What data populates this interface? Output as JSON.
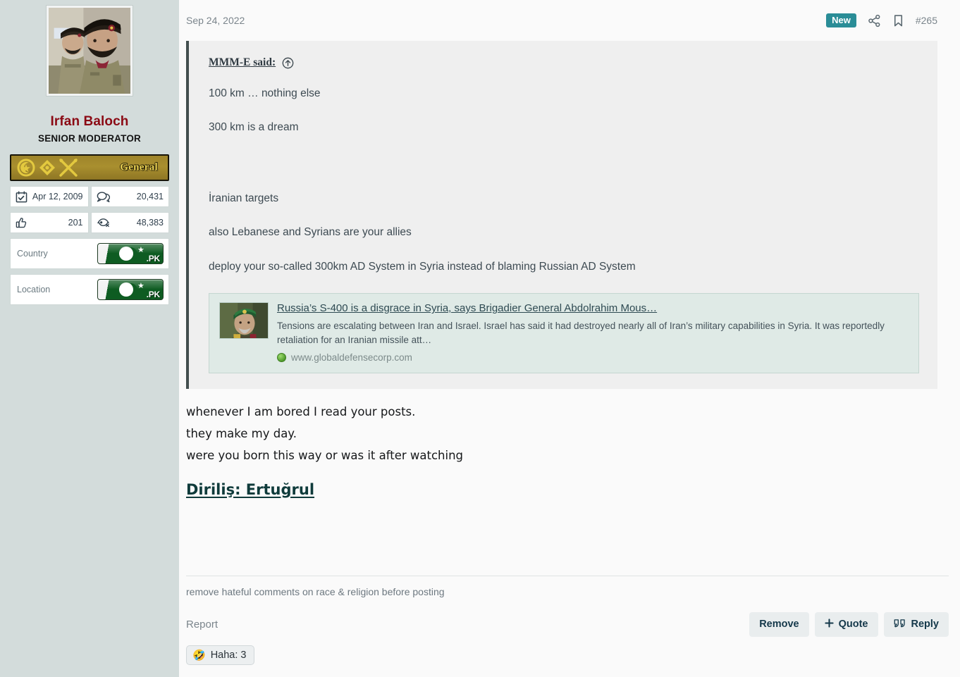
{
  "colors": {
    "sidebar_bg": "#d3dcdb",
    "main_bg": "#fafafa",
    "accent_teal": "#2a8d97",
    "username": "#8b0a14",
    "quote_bg": "#efefef",
    "quote_border": "#434f4f",
    "link_card_bg": "#dfeae6",
    "rank_badge_gold": "#a98f2f",
    "flag_green": "#0e5c22"
  },
  "sidebar": {
    "avatar_alt": "two-soldiers-avatar",
    "username": "Irfan Baloch",
    "user_title": "SENIOR MODERATOR",
    "rank": {
      "label": "General",
      "insignia": [
        "crescent-star-icon",
        "diamond-pip-icon",
        "crossed-batons-icon"
      ]
    },
    "stats": [
      {
        "icon": "calendar-icon",
        "value": "Apr 12, 2009",
        "name": "joined-date"
      },
      {
        "icon": "messages-icon",
        "value": "20,431",
        "name": "message-count"
      },
      {
        "icon": "thumbs-up-icon",
        "value": "201",
        "name": "likes-count"
      },
      {
        "icon": "reactions-icon",
        "value": "48,383",
        "name": "reaction-score"
      }
    ],
    "info": [
      {
        "label": "Country",
        "flag": "pakistan-flag",
        "tld": ".PK"
      },
      {
        "label": "Location",
        "flag": "pakistan-flag",
        "tld": ".PK"
      }
    ]
  },
  "post": {
    "date": "Sep 24, 2022",
    "new_badge": "New",
    "share_icon": "share-icon",
    "bookmark_icon": "bookmark-icon",
    "post_number": "#265",
    "quote": {
      "author": "MMM-E",
      "said_suffix": " said:",
      "jump_icon": "jump-to-post-icon",
      "lines": [
        "100 km … nothing else",
        "300 km is a dream"
      ],
      "lines2": [
        "İranian targets",
        "also Lebanese and Syrians are your allies",
        "deploy your so-called 300km AD System in Syria instead of blaming Russian AD System"
      ],
      "link_card": {
        "thumb_alt": "iranian-general-thumbnail",
        "title": "Russia’s S-400 is a disgrace in Syria, says Brigadier General Abdolrahim Mous…",
        "description": "Tensions are escalating between Iran and Israel. Israel has said it had destroyed nearly all of Iran’s military capabilities in Syria. It was reportedly retaliation for an Iranian missile att…",
        "host_icon": "globe-icon",
        "host": "www.globaldefensecorp.com"
      }
    },
    "body_lines": [
      "whenever I am bored I read your posts.",
      "they make my day.",
      "were you born this way or was it after watching"
    ],
    "body_link": "Diriliş: Ertuğrul",
    "signature": "remove hateful comments on race & religion before posting"
  },
  "footer": {
    "report_label": "Report",
    "buttons": [
      {
        "name": "remove-button",
        "label": "Remove",
        "icon": null
      },
      {
        "name": "quote-button",
        "label": "Quote",
        "icon": "plus-icon"
      },
      {
        "name": "reply-button",
        "label": "Reply",
        "icon": "quote-marks-icon"
      }
    ],
    "reaction": {
      "emoji": "🤣",
      "label": "Haha: 3"
    }
  }
}
